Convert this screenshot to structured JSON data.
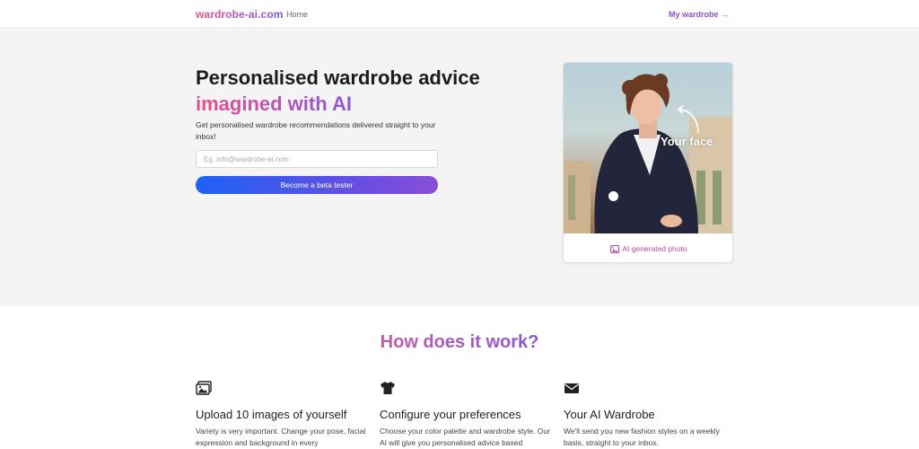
{
  "nav": {
    "brand": "wardrobe-ai.com",
    "home": "Home",
    "my_wardrobe": "My wardrobe →"
  },
  "hero": {
    "title_line1": "Personalised wardrobe advice",
    "title_line2": "imagined with AI",
    "description": "Get personalised wardrobe recommendations delivered straight to your inbox!",
    "email_placeholder": "Eg. info@wardrobe-ai.com",
    "cta_label": "Become a beta tester"
  },
  "photo_card": {
    "overlay_label": "Your face",
    "caption": "AI generated photo"
  },
  "how": {
    "title": "How does it work?",
    "features": [
      {
        "icon": "images-icon",
        "title": "Upload 10 images of yourself",
        "text": "Variety is very important. Change your pose, facial expression and background in every"
      },
      {
        "icon": "tshirt-icon",
        "title": "Configure your preferences",
        "text": "Choose your color palette and wardrobe style. Our AI will give you personalised advice based"
      },
      {
        "icon": "envelope-icon",
        "title": "Your AI Wardrobe",
        "text": "We'll send you new fashion styles on a weekly basis, straight to your inbox."
      }
    ]
  },
  "colors": {
    "accent_pink": "#ec4d8b",
    "accent_purple": "#8a5ad8",
    "cta_blue": "#1d62f5",
    "hero_bg": "#f4f4f4"
  }
}
